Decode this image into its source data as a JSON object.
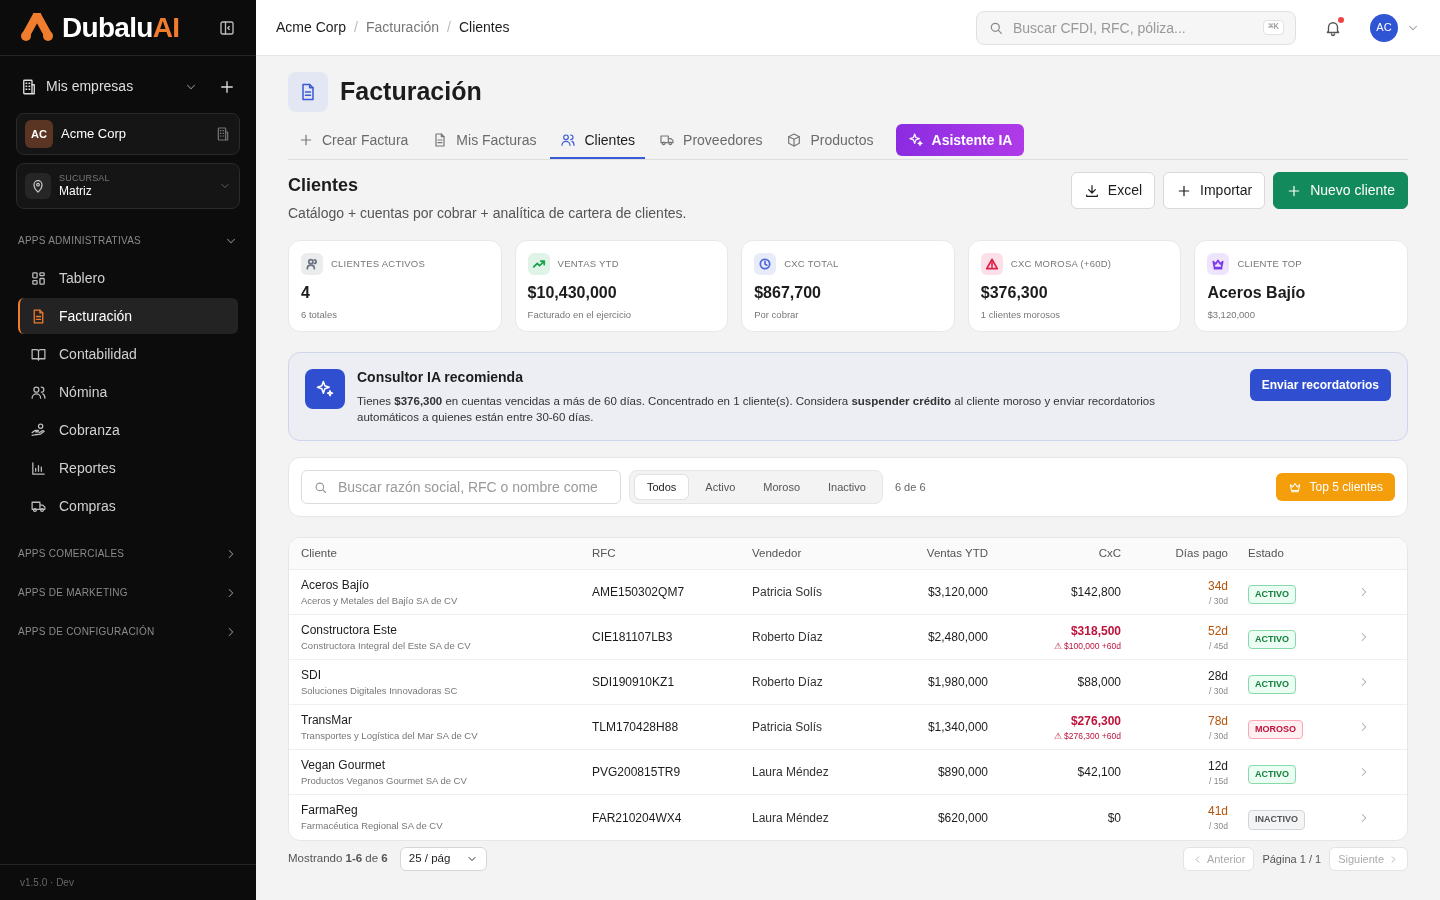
{
  "sidebar": {
    "brand": {
      "name": "Dubalu",
      "suffix": "AI"
    },
    "companies_label": "Mis empresas",
    "company": {
      "initials": "AC",
      "name": "Acme Corp"
    },
    "branch": {
      "label": "SUCURSAL",
      "value": "Matriz"
    },
    "sections": [
      {
        "title": "APPS ADMINISTRATIVAS",
        "expanded": true,
        "items": [
          {
            "label": "Tablero",
            "selected": false
          },
          {
            "label": "Facturación",
            "selected": true
          },
          {
            "label": "Contabilidad",
            "selected": false
          },
          {
            "label": "Nómina",
            "selected": false
          },
          {
            "label": "Cobranza",
            "selected": false
          },
          {
            "label": "Reportes",
            "selected": false
          },
          {
            "label": "Compras",
            "selected": false
          }
        ]
      },
      {
        "title": "APPS COMERCIALES",
        "expanded": false
      },
      {
        "title": "APPS DE MARKETING",
        "expanded": false
      },
      {
        "title": "APPS DE CONFIGURACIÓN",
        "expanded": false
      }
    ],
    "version": "v1.5.0 · Dev"
  },
  "topbar": {
    "breadcrumb": [
      "Acme Corp",
      "Facturación",
      "Clientes"
    ],
    "separator": "/",
    "search": {
      "placeholder": "Buscar CFDI, RFC, póliza...",
      "shortcut": "⌘K"
    },
    "notifications": true,
    "avatar": "AC"
  },
  "page": {
    "title": "Facturación",
    "tabs": [
      {
        "label": "Crear Factura",
        "kind": "plain",
        "selected": false
      },
      {
        "label": "Mis Facturas",
        "kind": "plain",
        "selected": false
      },
      {
        "label": "Clientes",
        "kind": "plain",
        "selected": true
      },
      {
        "label": "Proveedores",
        "kind": "plain",
        "selected": false
      },
      {
        "label": "Productos",
        "kind": "plain",
        "selected": false
      },
      {
        "label": "Asistente IA",
        "kind": "ai",
        "selected": false
      }
    ],
    "section": {
      "title": "Clientes",
      "subtitle": "Catálogo + cuentas por cobrar + analítica de cartera de clientes."
    },
    "actions": [
      {
        "label": "Excel",
        "kind": "outline"
      },
      {
        "label": "Importar",
        "kind": "outline"
      },
      {
        "label": "Nuevo cliente",
        "kind": "primary"
      }
    ],
    "kpis": [
      {
        "label": "CLIENTES ACTIVOS",
        "value": "4",
        "note": "6 totales",
        "color": "#6b7280"
      },
      {
        "label": "VENTAS YTD",
        "value": "$10,430,000",
        "note": "Facturado en el ejercicio",
        "color": "#16a34a"
      },
      {
        "label": "CXC TOTAL",
        "value": "$867,700",
        "note": "Por cobrar",
        "color": "#4f6bd8"
      },
      {
        "label": "CXC MOROSA (+60D)",
        "value": "$376,300",
        "note": "1 clientes morosos",
        "color": "#e11d48"
      },
      {
        "label": "CLIENTE TOP",
        "value": "Aceros Bajío",
        "note": "$3,120,000",
        "color": "#7c3aed"
      }
    ],
    "advisor": {
      "title": "Consultor IA recomienda",
      "message": "Tienes **$376,300** en cuentas vencidas a más de 60 días. Concentrado en 1 cliente(s). Considera **suspender crédito** al cliente moroso y enviar recordatorios automáticos a quienes están entre 30-60 días.",
      "button": "Enviar recordatorios"
    },
    "filters": {
      "search": {
        "placeholder": "Buscar razón social, RFC o nombre come"
      },
      "segments": [
        {
          "label": "Todos",
          "selected": true
        },
        {
          "label": "Activo",
          "selected": false
        },
        {
          "label": "Moroso",
          "selected": false
        },
        {
          "label": "Inactivo",
          "selected": false
        }
      ],
      "count": "6 de 6",
      "top_button": "Top 5 clientes"
    },
    "table": {
      "columns": [
        "Cliente",
        "RFC",
        "Vendedor",
        "Ventas YTD",
        "CxC",
        "Días pago",
        "Estado"
      ],
      "rows": [
        {
          "name": "Aceros Bajío",
          "legal": "Aceros y Metales del Bajío SA de CV",
          "rfc": "AME150302QM7",
          "seller": "Patricia Solís",
          "sales": "$3,120,000",
          "cxc": "$142,800",
          "overdue": false,
          "days": "34d",
          "terms": "/ 30d",
          "late": true,
          "status": "ACTIVO",
          "kind": "activo"
        },
        {
          "name": "Constructora Este",
          "legal": "Constructora Integral del Este SA de CV",
          "rfc": "CIE181107LB3",
          "seller": "Roberto Díaz",
          "sales": "$2,480,000",
          "cxc": "$318,500",
          "overdue": true,
          "overdue_note": "⚠ $100,000 +60d",
          "days": "52d",
          "terms": "/ 45d",
          "late": true,
          "status": "ACTIVO",
          "kind": "activo"
        },
        {
          "name": "SDI",
          "legal": "Soluciones Digitales Innovadoras SC",
          "rfc": "SDI190910KZ1",
          "seller": "Roberto Díaz",
          "sales": "$1,980,000",
          "cxc": "$88,000",
          "overdue": false,
          "days": "28d",
          "terms": "/ 30d",
          "late": false,
          "status": "ACTIVO",
          "kind": "activo"
        },
        {
          "name": "TransMar",
          "legal": "Transportes y Logística del Mar SA de CV",
          "rfc": "TLM170428H88",
          "seller": "Patricia Solís",
          "sales": "$1,340,000",
          "cxc": "$276,300",
          "overdue": true,
          "overdue_note": "⚠ $276,300 +60d",
          "days": "78d",
          "terms": "/ 30d",
          "late": true,
          "status": "MOROSO",
          "kind": "moroso"
        },
        {
          "name": "Vegan Gourmet",
          "legal": "Productos Veganos Gourmet SA de CV",
          "rfc": "PVG200815TR9",
          "seller": "Laura Méndez",
          "sales": "$890,000",
          "cxc": "$42,100",
          "overdue": false,
          "days": "12d",
          "terms": "/ 15d",
          "late": false,
          "status": "ACTIVO",
          "kind": "activo"
        },
        {
          "name": "FarmaReg",
          "legal": "Farmacéutica Regional SA de CV",
          "rfc": "FAR210204WX4",
          "seller": "Laura Méndez",
          "sales": "$620,000",
          "cxc": "$0",
          "overdue": false,
          "days": "41d",
          "terms": "/ 30d",
          "late": true,
          "status": "INACTIVO",
          "kind": "inactivo"
        }
      ]
    },
    "pagination": {
      "showing": "Mostrando **1-6** de **6**",
      "page_size": "25 / pág",
      "prev": "Anterior",
      "page": "Página 1 / 1",
      "next": "Siguiente"
    }
  }
}
